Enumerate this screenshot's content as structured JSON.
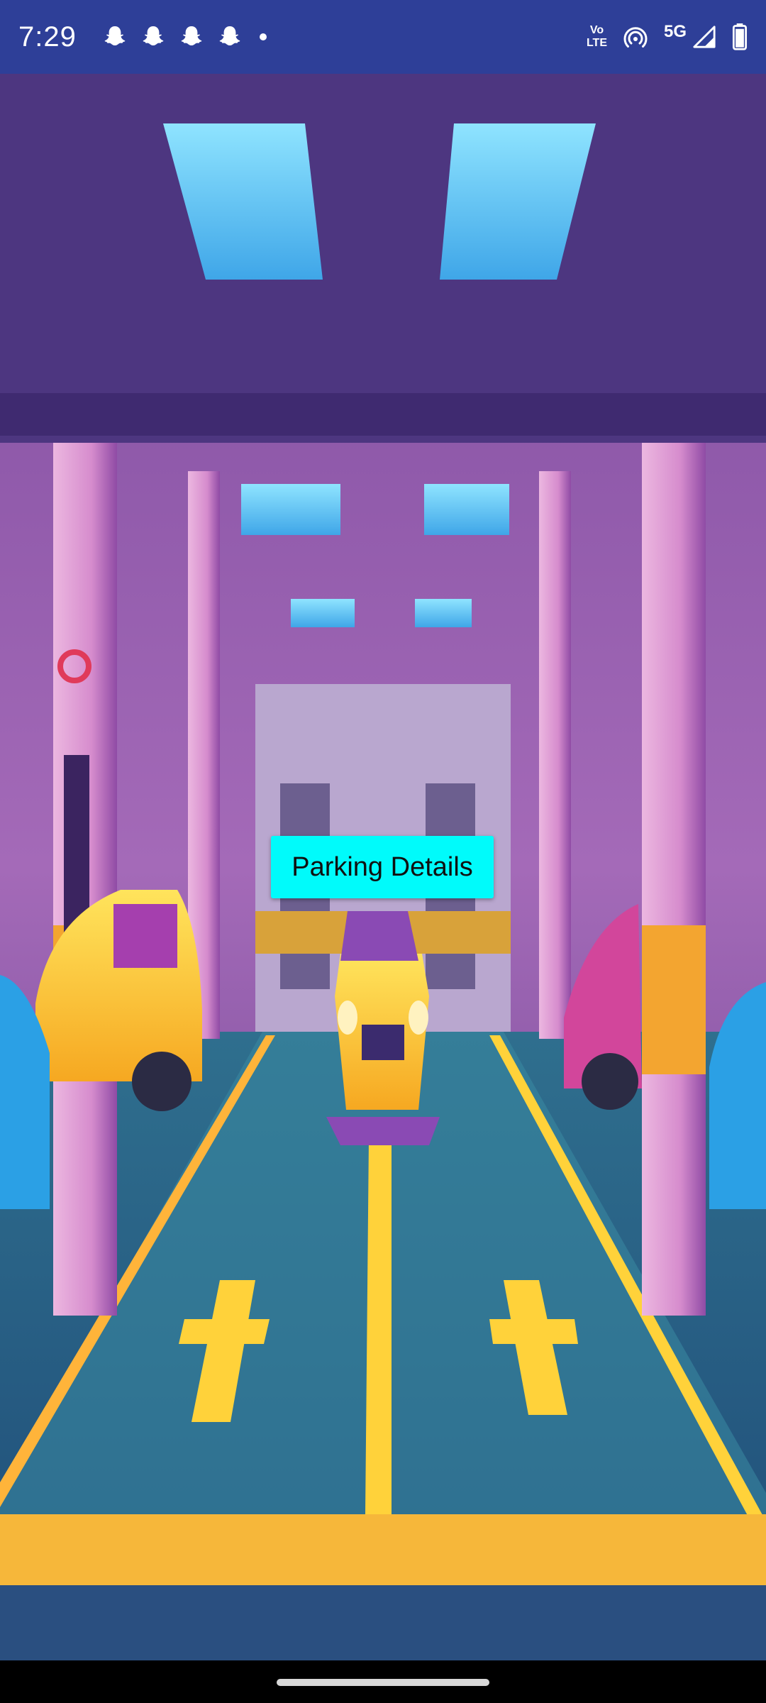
{
  "status_bar": {
    "time": "7:29",
    "notification_icons": [
      "snapchat-icon",
      "snapchat-icon",
      "snapchat-icon",
      "snapchat-icon"
    ],
    "volte_line1": "Vo",
    "volte_line2": "LTE",
    "network_type": "5G",
    "background_color": "#2e3f98"
  },
  "main": {
    "background_image": "parking-garage-illustration",
    "parking_button_label": "Parking Details",
    "parking_button_color": "#00fbfb"
  },
  "nav_bar": {
    "handle": "gesture-handle"
  }
}
